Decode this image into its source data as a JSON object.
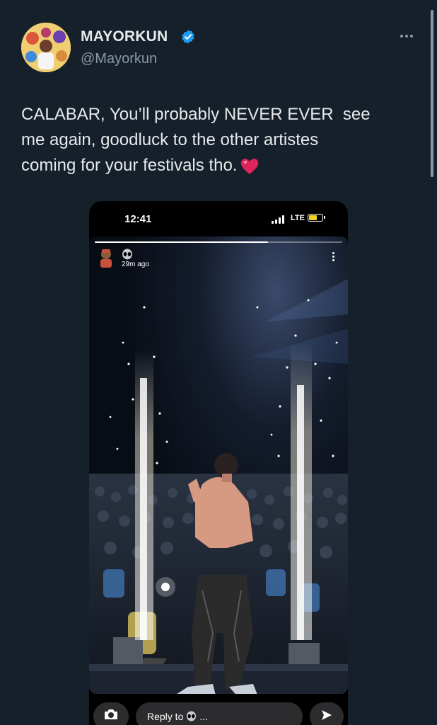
{
  "tweet": {
    "author_name": "MAYORKUN",
    "handle": "@Mayorkun",
    "verified": true,
    "text_lines": [
      "CALABAR, You’ll probably NEVER EVER  see",
      "me again, goodluck to the other artistes",
      "coming for your festivals tho."
    ],
    "emoji": "heart-emoji"
  },
  "embedded_story": {
    "status_bar": {
      "time": "12:41",
      "network": "LTE"
    },
    "posted_ago": "29m ago",
    "reply_placeholder": "Reply to",
    "reply_target_icon": "alien-emoji",
    "reply_ellipsis": "..."
  },
  "colors": {
    "background": "#15202b",
    "verified_badge": "#1d9bf0",
    "heart": "#e0245e"
  }
}
